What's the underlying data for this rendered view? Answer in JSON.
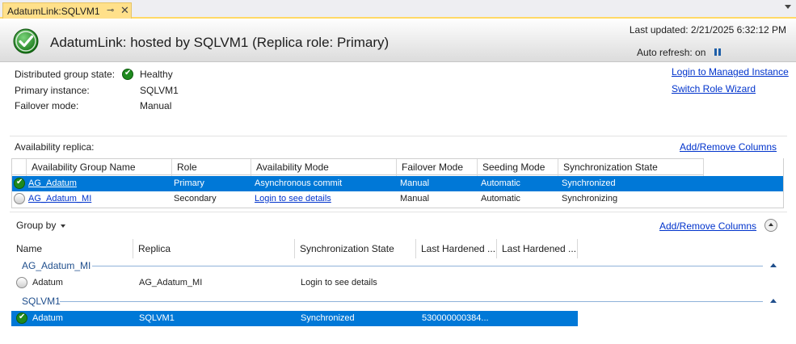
{
  "tab": {
    "title": "AdatumLink:SQLVM1",
    "pin_glyph": "⊸",
    "close_glyph": "✕"
  },
  "header": {
    "title": "AdatumLink: hosted by SQLVM1 (Replica role: Primary)",
    "last_updated": "Last updated: 2/21/2025 6:32:12 PM",
    "auto_refresh": "Auto refresh: on"
  },
  "info": {
    "state_label": "Distributed group state:",
    "state_value": "Healthy",
    "primary_label": "Primary instance:",
    "primary_value": "SQLVM1",
    "failover_label": "Failover mode:",
    "failover_value": "Manual"
  },
  "links": {
    "login_mi": "Login to Managed Instance",
    "switch_role": "Switch Role Wizard",
    "add_remove_1": "Add/Remove Columns",
    "add_remove_2": "Add/Remove Columns"
  },
  "replica": {
    "section_label": "Availability replica:",
    "columns": [
      "Availability Group Name",
      "Role",
      "Availability Mode",
      "Failover Mode",
      "Seeding Mode",
      "Synchronization State"
    ],
    "rows": [
      {
        "name": "AG_Adatum",
        "role": "Primary",
        "mode": "Asynchronous commit",
        "failover": "Manual",
        "seeding": "Automatic",
        "sync": "Synchronized",
        "status_icon": "status-ok-icon",
        "selected": true
      },
      {
        "name": "AG_Adatum_MI",
        "role": "Secondary",
        "mode": "Login to see details",
        "failover": "Manual",
        "seeding": "Automatic",
        "sync": "Synchronizing",
        "status_icon": "status-unknown-icon",
        "selected": false
      }
    ]
  },
  "databases": {
    "group_by": "Group by",
    "columns": [
      "Name",
      "Replica",
      "Synchronization State",
      "Last Hardened ...",
      "Last Hardened ..."
    ],
    "groups": [
      {
        "label": "AG_Adatum_MI",
        "rows": [
          {
            "name": "Adatum",
            "replica": "AG_Adatum_MI",
            "sync": "Login to see details",
            "lh1": "",
            "lh2": "",
            "selected": false
          }
        ]
      },
      {
        "label": "SQLVM1",
        "rows": [
          {
            "name": "Adatum",
            "replica": "SQLVM1",
            "sync": "Synchronized",
            "lh1": "530000000384...",
            "lh2": "",
            "selected": true
          }
        ]
      }
    ]
  },
  "colors": {
    "selection": "#0078d7",
    "link": "#0033cc",
    "tab_active": "#ffe08a",
    "ok_green": "#1e8a1e"
  }
}
